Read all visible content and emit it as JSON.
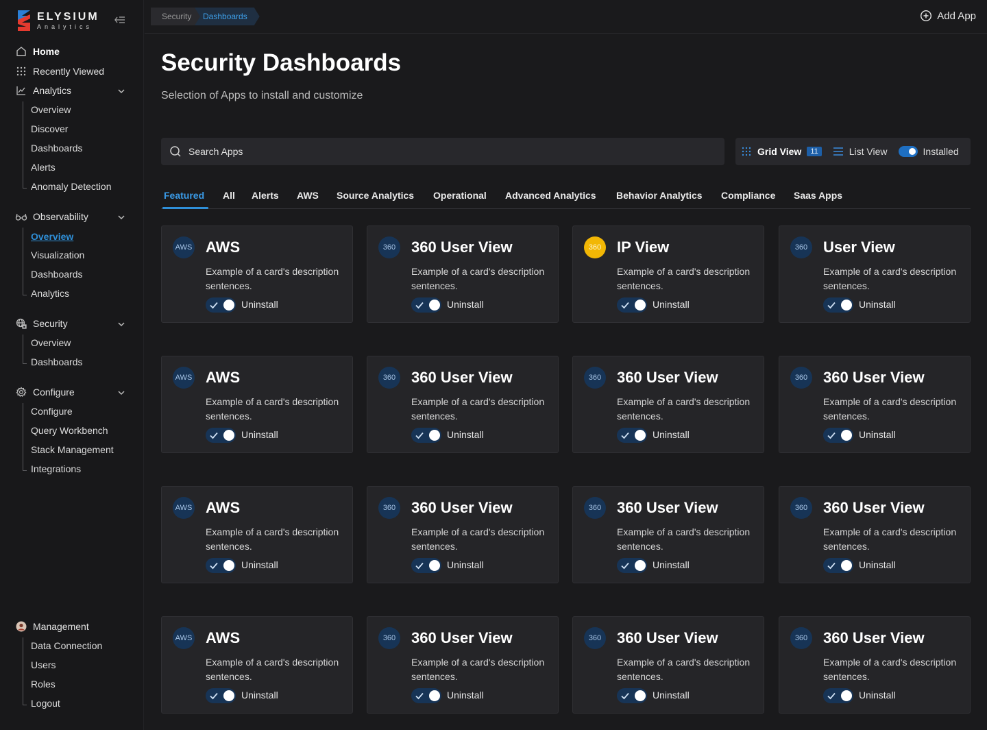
{
  "brand": {
    "name": "ELYSIUM",
    "sub": "Analytics"
  },
  "sidebar": {
    "home": "Home",
    "recently_viewed": "Recently Viewed",
    "analytics": {
      "label": "Analytics",
      "items": [
        "Overview",
        "Discover",
        "Dashboards",
        "Alerts",
        "Anomaly Detection"
      ]
    },
    "observability": {
      "label": "Observability",
      "items": [
        "Overview",
        "Visualization",
        "Dashboards",
        "Analytics"
      ]
    },
    "security": {
      "label": "Security",
      "items": [
        "Overview",
        "Dashboards"
      ]
    },
    "configure": {
      "label": "Configure",
      "items": [
        "Configure",
        "Query Workbench",
        "Stack Management",
        "Integrations"
      ]
    },
    "management": {
      "label": "Management",
      "items": [
        "Data Connection",
        "Users",
        "Roles",
        "Logout"
      ]
    }
  },
  "breadcrumb": [
    "Security",
    "Dashboards"
  ],
  "header": {
    "add_app": "Add App"
  },
  "page": {
    "title": "Security Dashboards",
    "subtitle": "Selection of Apps to install and customize"
  },
  "search": {
    "placeholder": "Search Apps"
  },
  "view": {
    "grid_label": "Grid View",
    "grid_count": "11",
    "list_label": "List View",
    "installed_label": "Installed",
    "installed_on": true
  },
  "tabs": [
    "Featured",
    "All",
    "Alerts",
    "AWS",
    "Source Analytics",
    "Operational",
    "Advanced Analytics",
    "Behavior Analytics",
    "Compliance",
    "Saas Apps"
  ],
  "cards": [
    {
      "logo": "AWS",
      "title": "AWS",
      "desc": "Example of a card's description sentences.",
      "action": "Uninstall"
    },
    {
      "logo": "360",
      "title": "360 User View",
      "desc": "Example of a card's description sentences.",
      "action": "Uninstall"
    },
    {
      "logo": "360",
      "title": "IP View",
      "desc": "Example of a card's description sentences.",
      "action": "Uninstall"
    },
    {
      "logo": "360",
      "title": "User View",
      "desc": "Example of a card's description sentences.",
      "action": "Uninstall"
    },
    {
      "logo": "AWS",
      "title": "AWS",
      "desc": "Example of a card's description sentences.",
      "action": "Uninstall"
    },
    {
      "logo": "360",
      "title": "360 User View",
      "desc": "Example of a card's description sentences.",
      "action": "Uninstall"
    },
    {
      "logo": "360",
      "title": "360 User View",
      "desc": "Example of a card's description sentences.",
      "action": "Uninstall"
    },
    {
      "logo": "360",
      "title": "360 User View",
      "desc": "Example of a card's description sentences.",
      "action": "Uninstall"
    },
    {
      "logo": "AWS",
      "title": "AWS",
      "desc": "Example of a card's description sentences.",
      "action": "Uninstall"
    },
    {
      "logo": "360",
      "title": "360 User View",
      "desc": "Example of a card's description sentences.",
      "action": "Uninstall"
    },
    {
      "logo": "360",
      "title": "360 User View",
      "desc": "Example of a card's description sentences.",
      "action": "Uninstall"
    },
    {
      "logo": "360",
      "title": "360 User View",
      "desc": "Example of a card's description sentences.",
      "action": "Uninstall"
    },
    {
      "logo": "AWS",
      "title": "AWS",
      "desc": "Example of a card's description sentences.",
      "action": "Uninstall"
    },
    {
      "logo": "360",
      "title": "360 User View",
      "desc": "Example of a card's description sentences.",
      "action": "Uninstall"
    },
    {
      "logo": "360",
      "title": "360 User View",
      "desc": "Example of a card's description sentences.",
      "action": "Uninstall"
    },
    {
      "logo": "360",
      "title": "360 User View",
      "desc": "Example of a card's description sentences.",
      "action": "Uninstall"
    }
  ],
  "colors": {
    "accent": "#2f8fd8",
    "highlight_logo": "#f2b705",
    "background": "#1a1a1c",
    "card": "#252528"
  }
}
